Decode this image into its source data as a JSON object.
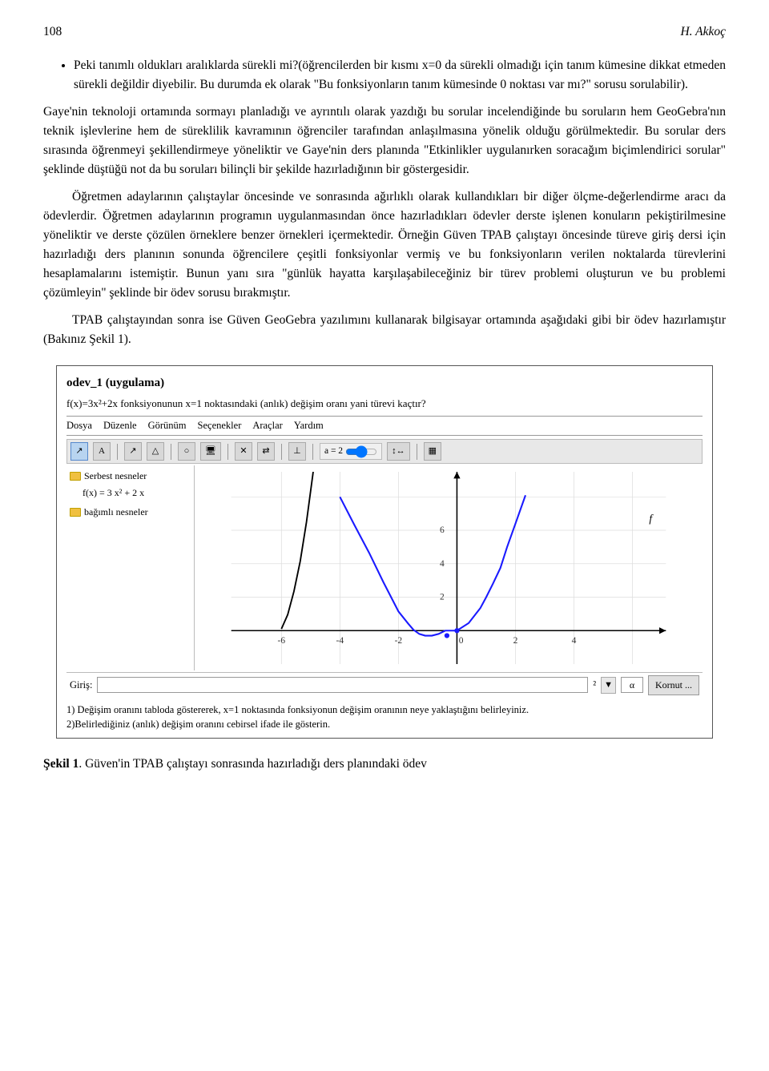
{
  "header": {
    "page_number": "108",
    "author": "H. Akkoç"
  },
  "content": {
    "bullet_item_1": "Peki tanımlı oldukları aralıklarda sürekli mi?(öğrencilerden bir kısmı x=0 da sürekli olmadığı için tanım kümesine dikkat etmeden sürekli değildir diyebilir. Bu durumda ek olarak \"Bu fonksiyonların tanım kümesinde 0 noktası var mı?\" sorusu sorulabilir).",
    "paragraph_1": "Gaye'nin teknoloji ortamında sormayı planladığı ve ayrıntılı olarak yazdığı bu sorular incelendiğinde bu soruların hem GeoGebra'nın teknik işlevlerine hem de süreklilik kavramının öğrenciler tarafından anlaşılmasına yönelik olduğu görülmektedir. Bu sorular ders sırasında öğrenmeyi şekillendirmeye yöneliktir ve Gaye'nin ders planında \"Etkinlikler uygulanırken soracağım biçimlendirici sorular\" şeklinde düştüğü not da bu soruları bilinçli bir şekilde hazırladığının bir göstergesidir.",
    "paragraph_2": "Öğretmen adaylarının çalıştaylar öncesinde ve sonrasında ağırlıklı olarak kullandıkları bir diğer ölçme-değerlendirme aracı da ödevlerdir. Öğretmen adaylarının programın uygulanmasından önce hazırladıkları ödevler derste işlenen konuların pekiştirilmesine yöneliktir ve derste çözülen örneklere benzer örnekleri içermektedir. Örneğin Güven TPAB çalıştayı öncesinde türeve giriş dersi için hazırladığı ders planının sonunda öğrencilere çeşitli fonksiyonlar vermiş ve bu fonksiyonların verilen noktalarda türevlerini hesaplamalarını istemiştir. Bunun yanı sıra \"günlük hayatta karşılaşabileceğiniz bir türev problemi oluşturun ve bu problemi çözümleyin\" şeklinde bir ödev sorusu bırakmıştır.",
    "paragraph_3": "TPAB çalıştayından sonra ise Güven GeoGebra yazılımını kullanarak bilgisayar ortamında aşağıdaki gibi bir ödev hazırlamıştır (Bakınız Şekil 1).",
    "figure": {
      "title": "odev_1 (uygulama)",
      "question": "f(x)=3x²+2x fonksiyonunun x=1 noktasındaki (anlık) değişim oranı yani türevi kaçtır?",
      "menubar": [
        "Dosya",
        "Düzenle",
        "Görünüm",
        "Seçenekler",
        "Araçlar",
        "Yardım"
      ],
      "sidebar_folders": [
        "Serbest nesneler",
        "f(x) = 3 x² + 2 x",
        "bağımlı nesneler"
      ],
      "slider_label": "a = 2",
      "input_label": "Giriş:",
      "alpha_label": "α",
      "kornut_label": "Kornut ...",
      "instruction_1": "1) Değişim oranını tabloda göstererek, x=1 noktasında fonksiyonun değişim oranının neye yaklaştığını belirleyiniz.",
      "instruction_2": "2)Belirlediğiniz (anlık) değişim oranını cebirsel ifade ile gösterin.",
      "axes": {
        "x_labels": [
          "-6",
          "-4",
          "-2",
          "0",
          "2",
          "4"
        ],
        "y_labels": [
          "2",
          "4",
          "6"
        ],
        "f_label": "f"
      }
    },
    "caption": "Şekil 1",
    "caption_text": ". Güven'in TPAB çalıştayı sonrasında hazırladığı ders planındaki ödev"
  }
}
